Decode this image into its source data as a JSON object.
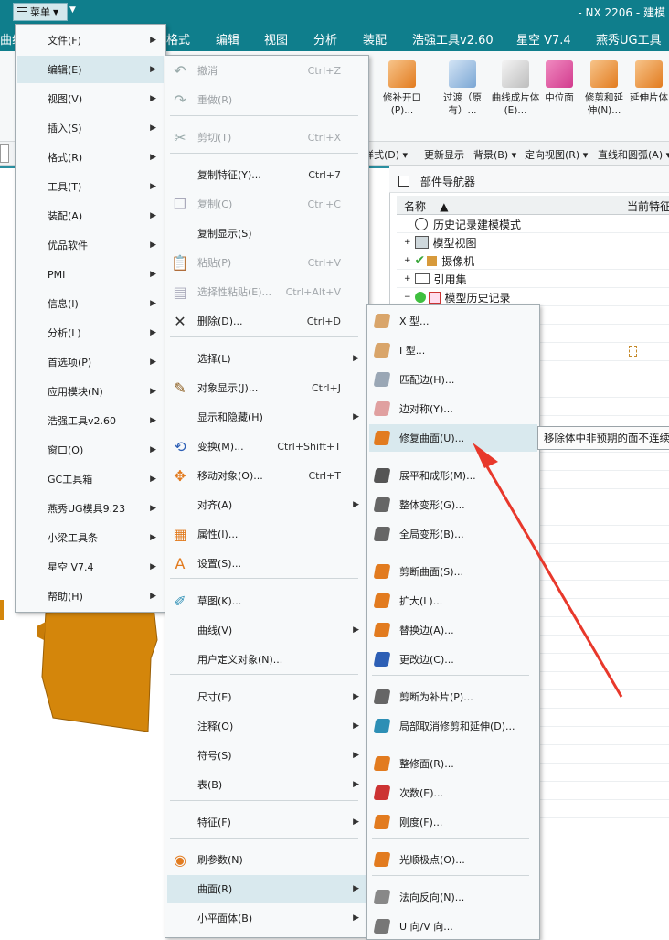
{
  "titlebar": {
    "menu_label": "菜单",
    "app_title": "- NX 2206 - 建模"
  },
  "ribbon_tabs": [
    "曲线",
    "格式",
    "编辑",
    "视图",
    "分析",
    "装配",
    "浩强工具v2.60",
    "星空 V7.4",
    "燕秀UG工具"
  ],
  "ribbon_buttons": [
    {
      "label": "修补开口(P)...",
      "color": "#e27b1f"
    },
    {
      "label": "过渡（原有）...",
      "color": "#7aa6d4"
    },
    {
      "label": "曲线成片体(E)...",
      "color": "#c9c9c9"
    },
    {
      "label": "中位面",
      "color": "#d23b8e"
    },
    {
      "label": "修剪和延伸(N)...",
      "color": "#e27b1f"
    },
    {
      "label": "延伸片体",
      "color": "#e27b1f"
    }
  ],
  "ribbon_row": [
    "样式(D)",
    "更新显示",
    "背景(B)",
    "定向视图(R)",
    "直线和圆弧(A)"
  ],
  "navigator": {
    "title": "部件导航器",
    "col_name": "名称",
    "col_feature": "当前特征",
    "rows": [
      "历史记录建模模式",
      "模型视图",
      "摄像机",
      "引用集",
      "模型历史记录"
    ]
  },
  "main_menu": [
    {
      "label": "文件(F)"
    },
    {
      "label": "编辑(E)"
    },
    {
      "label": "视图(V)"
    },
    {
      "label": "插入(S)"
    },
    {
      "label": "格式(R)"
    },
    {
      "label": "工具(T)"
    },
    {
      "label": "装配(A)"
    },
    {
      "label": "优品软件"
    },
    {
      "label": "PMI"
    },
    {
      "label": "信息(I)"
    },
    {
      "label": "分析(L)"
    },
    {
      "label": "首选项(P)"
    },
    {
      "label": "应用模块(N)"
    },
    {
      "label": "浩强工具v2.60"
    },
    {
      "label": "窗口(O)"
    },
    {
      "label": "GC工具箱"
    },
    {
      "label": "燕秀UG模具9.23"
    },
    {
      "label": "小梁工具条"
    },
    {
      "label": "星空 V7.4"
    },
    {
      "label": "帮助(H)"
    }
  ],
  "edit_menu": [
    {
      "label": "撤消",
      "sc": "Ctrl+Z"
    },
    {
      "label": "重做(R)",
      "sc": ""
    },
    {
      "label": "剪切(T)",
      "sc": "Ctrl+X"
    },
    {
      "label": "复制特征(Y)...",
      "sc": "Ctrl+7"
    },
    {
      "label": "复制(C)",
      "sc": "Ctrl+C"
    },
    {
      "label": "复制显示(S)",
      "sc": ""
    },
    {
      "label": "粘贴(P)",
      "sc": "Ctrl+V"
    },
    {
      "label": "选择性粘贴(E)...",
      "sc": "Ctrl+Alt+V"
    },
    {
      "label": "删除(D)...",
      "sc": "Ctrl+D"
    },
    {
      "label": "选择(L)",
      "sc": ""
    },
    {
      "label": "对象显示(J)...",
      "sc": "Ctrl+J"
    },
    {
      "label": "显示和隐藏(H)",
      "sc": ""
    },
    {
      "label": "变换(M)...",
      "sc": "Ctrl+Shift+T"
    },
    {
      "label": "移动对象(O)...",
      "sc": "Ctrl+T"
    },
    {
      "label": "对齐(A)",
      "sc": ""
    },
    {
      "label": "属性(I)...",
      "sc": ""
    },
    {
      "label": "设置(S)...",
      "sc": ""
    },
    {
      "label": "草图(K)...",
      "sc": ""
    },
    {
      "label": "曲线(V)",
      "sc": ""
    },
    {
      "label": "用户定义对象(N)...",
      "sc": ""
    },
    {
      "label": "尺寸(E)",
      "sc": ""
    },
    {
      "label": "注释(O)",
      "sc": ""
    },
    {
      "label": "符号(S)",
      "sc": ""
    },
    {
      "label": "表(B)",
      "sc": ""
    },
    {
      "label": "特征(F)",
      "sc": ""
    },
    {
      "label": "刷参数(N)",
      "sc": ""
    },
    {
      "label": "曲面(R)",
      "sc": ""
    },
    {
      "label": "小平面体(B)",
      "sc": ""
    }
  ],
  "surface_menu": [
    {
      "label": "X 型..."
    },
    {
      "label": "I 型..."
    },
    {
      "label": "匹配边(H)..."
    },
    {
      "label": "边对称(Y)..."
    },
    {
      "label": "修复曲面(U)..."
    },
    {
      "label": "展平和成形(M)..."
    },
    {
      "label": "整体变形(G)..."
    },
    {
      "label": "全局变形(B)..."
    },
    {
      "label": "剪断曲面(S)..."
    },
    {
      "label": "扩大(L)..."
    },
    {
      "label": "替换边(A)..."
    },
    {
      "label": "更改边(C)..."
    },
    {
      "label": "剪断为补片(P)..."
    },
    {
      "label": "局部取消修剪和延伸(D)..."
    },
    {
      "label": "整修面(R)..."
    },
    {
      "label": "次数(E)..."
    },
    {
      "label": "刚度(F)..."
    },
    {
      "label": "光顺极点(O)..."
    },
    {
      "label": "法向反向(N)..."
    },
    {
      "label": "U 向/V 向..."
    }
  ],
  "tooltip": "移除体中非预期的面不连续",
  "colors": {
    "title": "#0f7e8c",
    "highlight": "#d9e9ee",
    "accent": "#e27b1f",
    "arrow": "#e8382b"
  }
}
